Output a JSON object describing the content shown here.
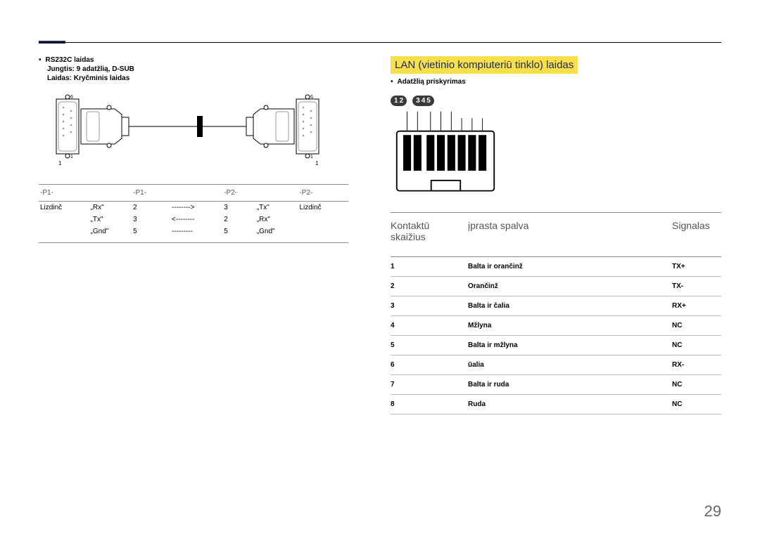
{
  "left": {
    "bullet": "•",
    "title": "RS232C laidas",
    "sub1": "Jungtis: 9 adatžlią, D-SUB",
    "sub2": "Laidas: Kryčminis laidas",
    "diagram": {
      "topLeft": "6",
      "botLeft": "1",
      "topRight": "6",
      "botRight": "1",
      "labelL": "1",
      "labelR": "1"
    },
    "table": {
      "headers": [
        "-P1-",
        "-P1-",
        "",
        "",
        "",
        "-P2-",
        "-P2-"
      ],
      "rows": [
        [
          "Lizdinč",
          "„Rx\"",
          "2",
          "-------->",
          "3",
          "„Tx\"",
          "Lizdinč"
        ],
        [
          "",
          "„Tx\"",
          "3",
          "<--------",
          "2",
          "„Rx\"",
          ""
        ],
        [
          "",
          "„Gnd\"",
          "5",
          "---------",
          "5",
          "„Gnd\"",
          ""
        ]
      ]
    }
  },
  "right": {
    "section_title": "LAN (vietinio kompiuteriū tinklo) laidas",
    "bullet": "•",
    "bullet_label": "Adatžlią priskyrimas",
    "badges": [
      [
        "1",
        "2"
      ],
      [
        "3",
        "4",
        "5"
      ]
    ],
    "table": {
      "headers": [
        "Kontaktū skaižius",
        "įprasta spalva",
        "Signalas"
      ],
      "rows": [
        {
          "n": "1",
          "color": "Balta ir orančinž",
          "sig": "TX+"
        },
        {
          "n": "2",
          "color": "Orančinž",
          "sig": "TX-"
        },
        {
          "n": "3",
          "color": "Balta ir čalia",
          "sig": "RX+"
        },
        {
          "n": "4",
          "color": "Mžlyna",
          "sig": "NC"
        },
        {
          "n": "5",
          "color": "Balta ir mžlyna",
          "sig": "NC"
        },
        {
          "n": "6",
          "color": "ūalia",
          "sig": "RX-"
        },
        {
          "n": "7",
          "color": "Balta ir ruda",
          "sig": "NC"
        },
        {
          "n": "8",
          "color": "Ruda",
          "sig": "NC"
        }
      ]
    }
  },
  "page_number": "29"
}
